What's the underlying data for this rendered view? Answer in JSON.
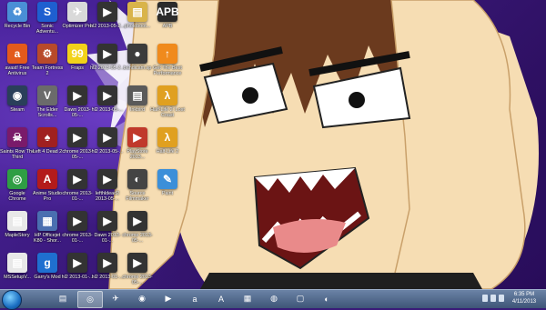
{
  "desktop": {
    "icons": [
      {
        "label": "Recycle Bin",
        "glyph": "♻",
        "color": "#4a8fd6"
      },
      {
        "label": "Sonic Adventu...",
        "glyph": "S",
        "color": "#1e5fd0"
      },
      {
        "label": "Optimizer Pro",
        "glyph": "✈",
        "color": "#d9d9d9"
      },
      {
        "label": "hl2 2013-05-2...",
        "glyph": "▶",
        "color": "#333333"
      },
      {
        "label": "photoboot...",
        "glyph": "▤",
        "color": "#d9b44a"
      },
      {
        "label": "APB",
        "glyph": "APB",
        "color": "#2b2b2b"
      },
      {
        "label": "avast! Free Antivirus",
        "glyph": "a",
        "color": "#e35a1c"
      },
      {
        "label": "Team Fortress 2",
        "glyph": "⚙",
        "color": "#b84a2a"
      },
      {
        "label": "Fraps",
        "glyph": "99",
        "color": "#f2d21a"
      },
      {
        "label": "hl2 2013-05-2...",
        "glyph": "▶",
        "color": "#333333"
      },
      {
        "label": "bandicam.sp",
        "glyph": "●",
        "color": "#3b3b3b"
      },
      {
        "label": "Get The Best Performance",
        "glyph": "↑",
        "color": "#f08a1c"
      },
      {
        "label": "Steam",
        "glyph": "◉",
        "color": "#2a3f5a"
      },
      {
        "label": "The Elder Scrolls...",
        "glyph": "V",
        "color": "#6b6b6b"
      },
      {
        "label": "Dawn 2013-05-...",
        "glyph": "▶",
        "color": "#333333"
      },
      {
        "label": "hl2 2013-05-...",
        "glyph": "▶",
        "color": "#333333"
      },
      {
        "label": "Inkbird",
        "glyph": "▤",
        "color": "#5a5a5a"
      },
      {
        "label": "Half-Life 2: Lost Coast",
        "glyph": "λ",
        "color": "#e0a020"
      },
      {
        "label": "Saints Row The Third",
        "glyph": "☠",
        "color": "#7a1a6a"
      },
      {
        "label": "Left 4 Dead 2",
        "glyph": "♠",
        "color": "#a02020"
      },
      {
        "label": "chrome 2013-05-...",
        "glyph": "▶",
        "color": "#333333"
      },
      {
        "label": "hl2 2013-05-...",
        "glyph": "▶",
        "color": "#333333"
      },
      {
        "label": "PlayStore 2013...",
        "glyph": "▶",
        "color": "#c0392b"
      },
      {
        "label": "Half-Life 2",
        "glyph": "λ",
        "color": "#e0a020"
      },
      {
        "label": "Google Chrome",
        "glyph": "◎",
        "color": "#2f9e44"
      },
      {
        "label": "Anime Studio Pro",
        "glyph": "A",
        "color": "#b31b1b"
      },
      {
        "label": "chrome 2013-01-...",
        "glyph": "▶",
        "color": "#333333"
      },
      {
        "label": "lefthldead2 2013-05-...",
        "glyph": "▶",
        "color": "#333333"
      },
      {
        "label": "Source Filmmaker",
        "glyph": "◐",
        "color": "#444444"
      },
      {
        "label": "Paint",
        "glyph": "✎",
        "color": "#3b8fd9"
      },
      {
        "label": "MapleStory",
        "glyph": "▤",
        "color": "#e8e8e8"
      },
      {
        "label": "HP Officejet K80 - Shor...",
        "glyph": "▦",
        "color": "#4a6fb0"
      },
      {
        "label": "chrome 2013-01-...",
        "glyph": "▶",
        "color": "#333333"
      },
      {
        "label": "Dawn 2013-01-...",
        "glyph": "▶",
        "color": "#333333"
      },
      {
        "label": "chrome 2013-05-...",
        "glyph": "▶",
        "color": "#333333"
      },
      {
        "label": "MSSetupV...",
        "glyph": "▤",
        "color": "#e8e8e8"
      },
      {
        "label": "Garry's Mod",
        "glyph": "g",
        "color": "#1f6fd0"
      },
      {
        "label": "hl2 2013-01-...",
        "glyph": "▶",
        "color": "#333333"
      },
      {
        "label": "hl2 2013-01-...",
        "glyph": "▶",
        "color": "#333333"
      },
      {
        "label": "chrome 2013-05-...",
        "glyph": "▶",
        "color": "#333333"
      }
    ]
  },
  "taskbar": {
    "pinned": [
      {
        "name": "explorer-icon",
        "glyph": "▤",
        "active": false
      },
      {
        "name": "chrome-icon",
        "glyph": "◎",
        "active": true
      },
      {
        "name": "optimizer-icon",
        "glyph": "✈",
        "active": false
      },
      {
        "name": "steam-icon",
        "glyph": "◉",
        "active": false
      },
      {
        "name": "media-player-icon",
        "glyph": "▶",
        "active": false
      },
      {
        "name": "avast-icon",
        "glyph": "a",
        "active": false
      },
      {
        "name": "anime-studio-icon",
        "glyph": "A",
        "active": false
      },
      {
        "name": "terminal-icon",
        "glyph": "▦",
        "active": false
      },
      {
        "name": "network-icon",
        "glyph": "◍",
        "active": false
      },
      {
        "name": "window-icon",
        "glyph": "▢",
        "active": false
      },
      {
        "name": "source-filmmaker-icon",
        "glyph": "◐",
        "active": false
      }
    ],
    "clock_time": "6:35 PM",
    "clock_date": "4/11/2013"
  }
}
